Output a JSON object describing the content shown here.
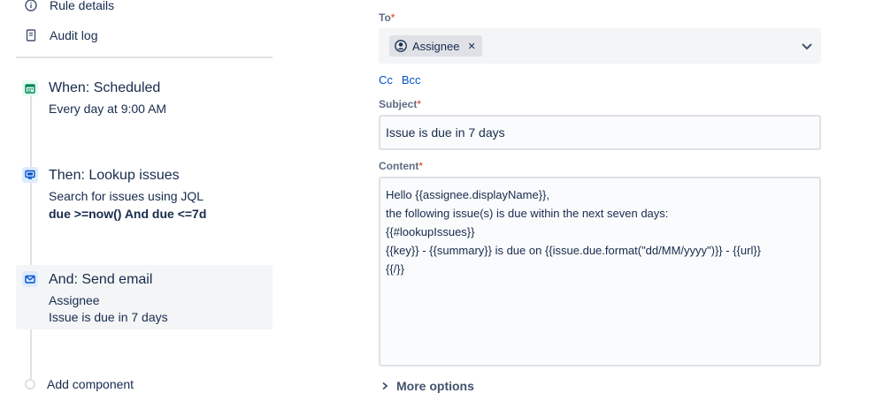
{
  "nav": {
    "rule_details": "Rule details",
    "audit_log": "Audit log"
  },
  "steps": [
    {
      "title": "When: Scheduled",
      "lines": [
        "Every day at 9:00 AM"
      ],
      "icon": "calendar-icon",
      "color": "#00875a"
    },
    {
      "title": "Then: Lookup issues",
      "lines": [
        "Search for issues using JQL",
        "due >=now() And due <=7d"
      ],
      "icon": "monitor-icon",
      "color": "#0052cc"
    },
    {
      "title": "And: Send email",
      "lines": [
        "Assignee",
        "Issue is due in 7 days"
      ],
      "icon": "mail-icon",
      "color": "#0052cc"
    }
  ],
  "add_component": "Add component",
  "form": {
    "to_label": "To",
    "to_chip": "Assignee",
    "cc": "Cc",
    "bcc": "Bcc",
    "subject_label": "Subject",
    "subject_value": "Issue is due in 7 days",
    "content_label": "Content",
    "content_lines": [
      "Hello {{assignee.displayName}},",
      "the following issue(s) is due within the next seven days:",
      "{{#lookupIssues}}",
      "{{key}} - {{summary}} is due on {{issue.due.format(\"dd/MM/yyyy\")}} - {{url}}",
      "{{/}}"
    ],
    "required_mark": "*",
    "more_options": "More options"
  },
  "colors": {
    "accent": "#0052cc",
    "required": "#de350b",
    "text": "#172b4d",
    "border": "#dfe1e6"
  }
}
